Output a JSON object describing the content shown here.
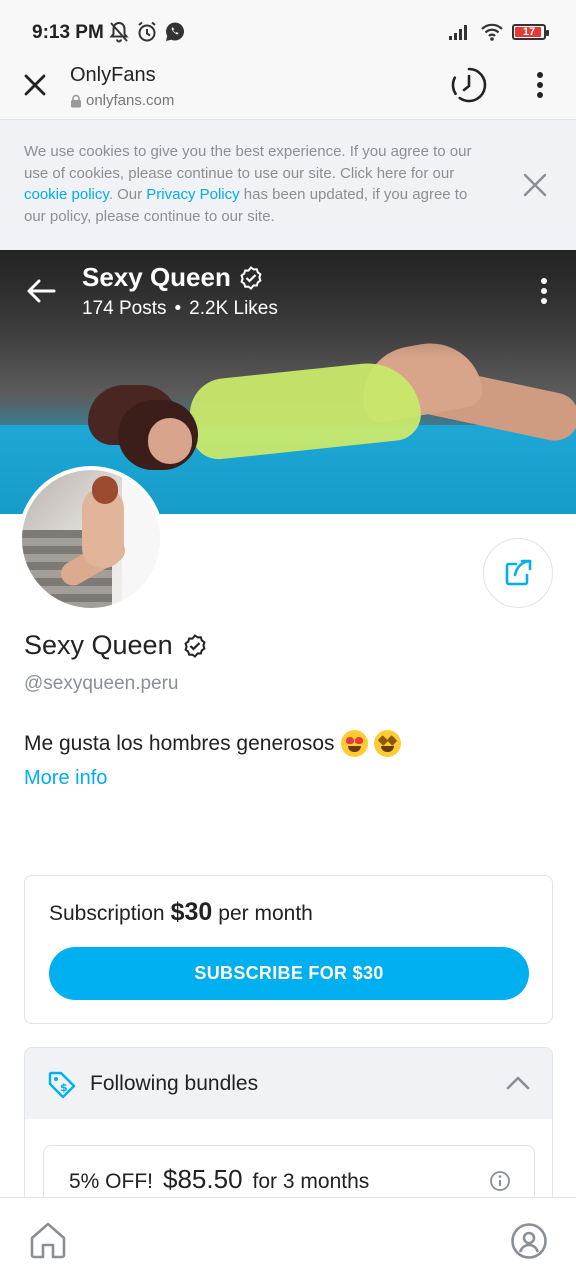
{
  "status_bar": {
    "time": "9:13 PM",
    "battery": "17",
    "icons_left": [
      "mute-bell-icon",
      "alarm-icon",
      "whatsapp-icon"
    ],
    "icons_right": [
      "signal-icon",
      "wifi-icon",
      "battery-icon"
    ]
  },
  "browser": {
    "title": "OnlyFans",
    "url": "onlyfans.com"
  },
  "cookie_banner": {
    "text_1": "We use cookies to give you the best experience. If you agree to our use of cookies, please continue to use our site. Click here for our ",
    "link_cookie": "cookie policy",
    "text_2": ". Our ",
    "link_privacy": "Privacy Policy",
    "text_3": " has been updated, if you agree to our policy, please continue to our site."
  },
  "cover": {
    "name": "Sexy Queen",
    "posts": "174 Posts",
    "separator": "•",
    "likes": "2.2K Likes"
  },
  "profile": {
    "name": "Sexy Queen",
    "handle": "@sexyqueen.peru",
    "bio": "Me gusta los hombres generosos",
    "more_info": "More info"
  },
  "subscription": {
    "label": "Subscription",
    "price": "$30",
    "period": "per month",
    "button": "SUBSCRIBE FOR $30"
  },
  "bundles": {
    "title": "Following bundles",
    "items": [
      {
        "discount": "5% OFF!",
        "price": "$85.50",
        "duration": "for 3 months"
      }
    ]
  },
  "colors": {
    "accent": "#00aff0",
    "link": "#00aeef",
    "battery_low": "#e53935"
  }
}
